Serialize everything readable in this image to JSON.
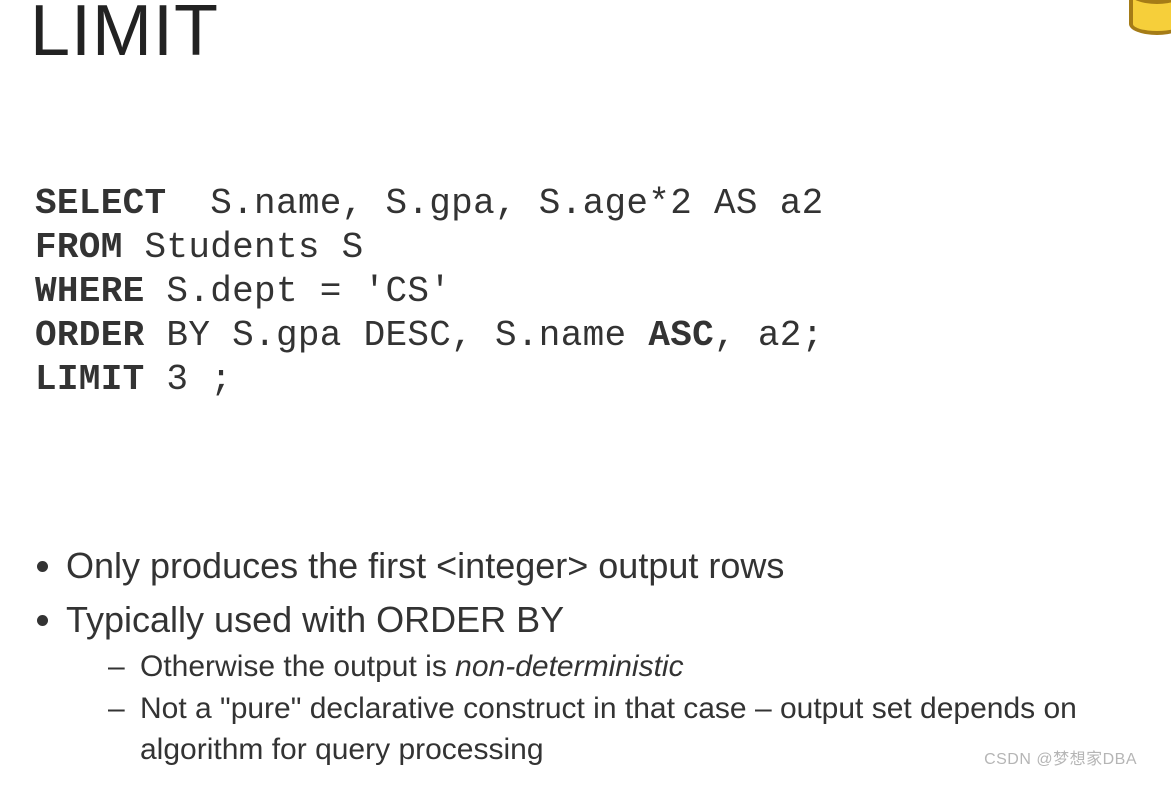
{
  "title": "LIMIT",
  "code": {
    "l1_kw": "SELECT",
    "l1_txt": "  S.name, S.gpa, S.age*2 AS a2",
    "l2_kw": "FROM",
    "l2_txt": " Students S",
    "l3_kw": "WHERE",
    "l3_txt": " S.dept = 'CS'",
    "l4_kw1": "ORDER",
    "l4_mid": " BY S.gpa DESC, S.name ",
    "l4_kw2": "ASC",
    "l4_end": ", a2;",
    "l5_kw": "LIMIT",
    "l5_txt": " 3 ;"
  },
  "bullets": {
    "b1": "Only produces the first <integer> output rows",
    "b2": "Typically used with ORDER BY",
    "s1a": "Otherwise the output is ",
    "s1em": "non-deterministic",
    "s2": "Not a \"pure\" declarative construct in that case – output set depends on algorithm for query processing"
  },
  "watermark": "CSDN @梦想家DBA"
}
